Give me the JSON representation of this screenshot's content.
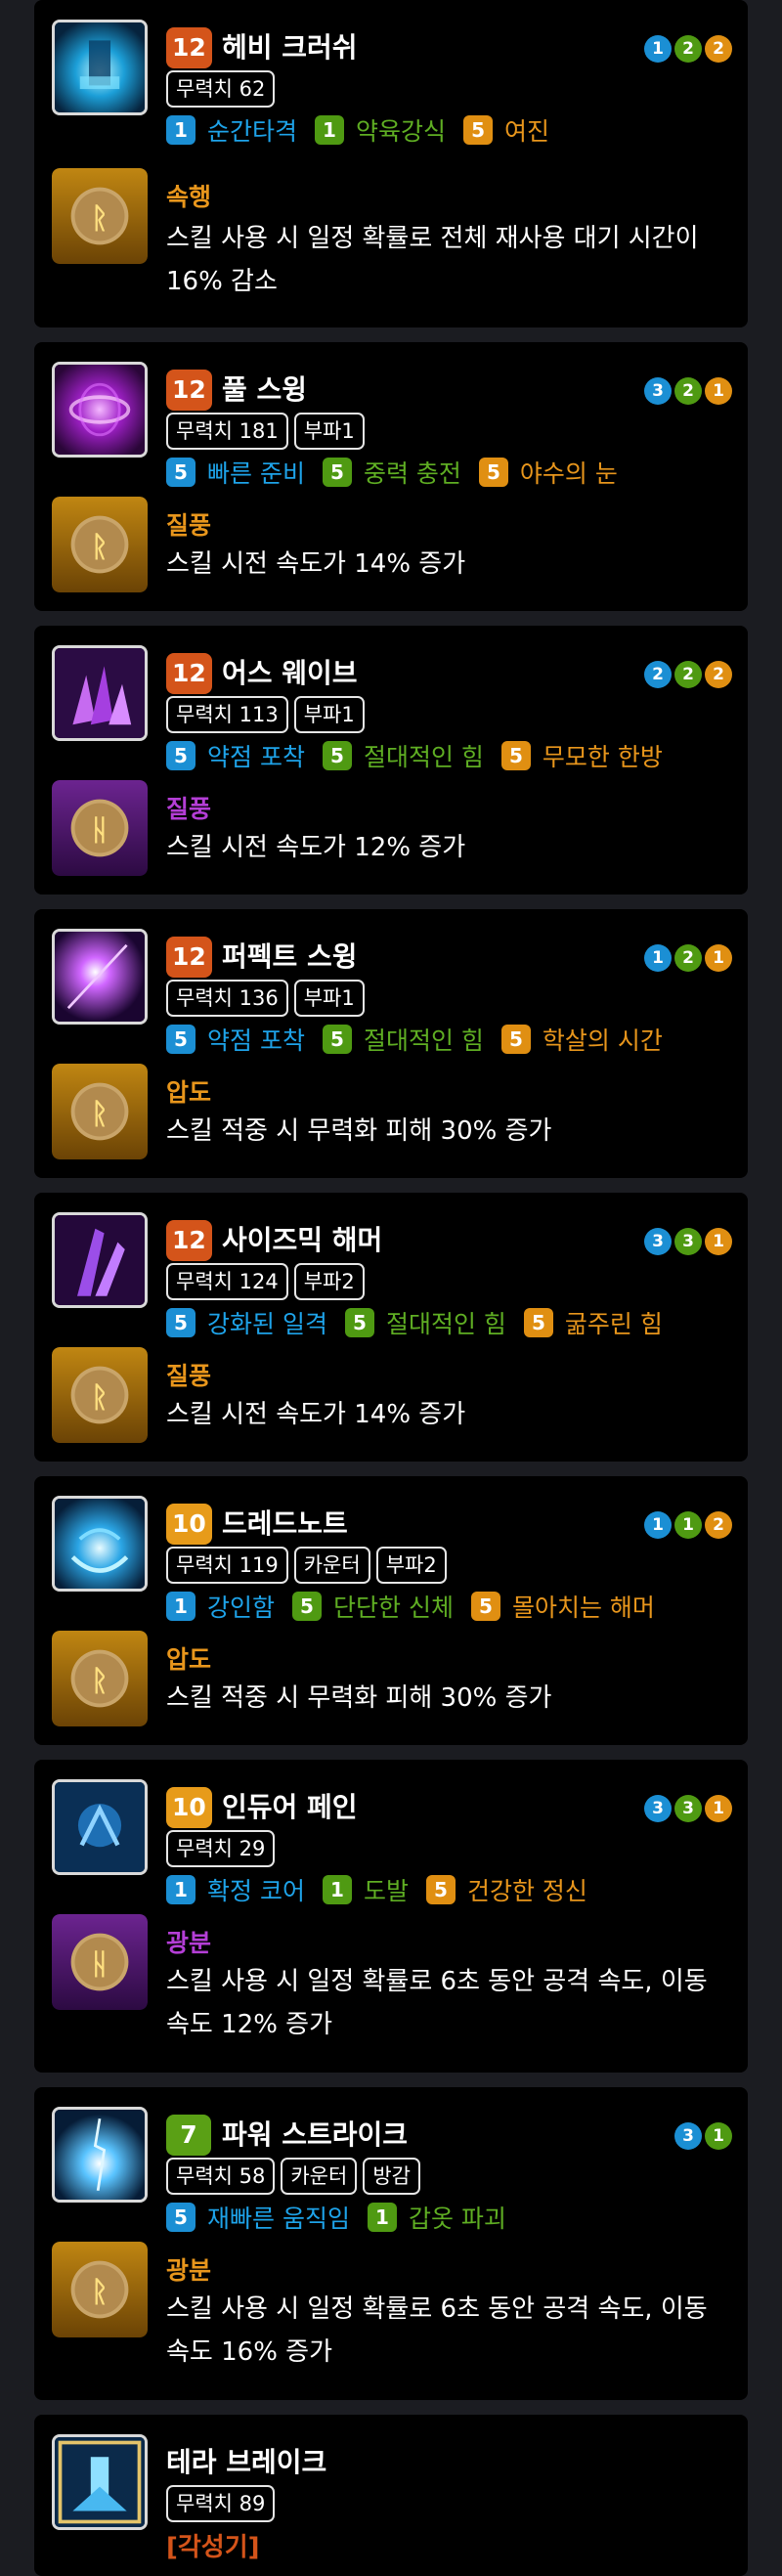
{
  "skills": [
    {
      "level": "12",
      "level_color": "#d4541a",
      "name": "헤비 크러쉬",
      "gems": [
        {
          "n": "1",
          "c": "blue"
        },
        {
          "n": "2",
          "c": "green"
        },
        {
          "n": "2",
          "c": "orange"
        }
      ],
      "tags": [
        "무력치 62"
      ],
      "tripods": [
        {
          "n": "1",
          "c": "blue",
          "label": "순간타격"
        },
        {
          "n": "1",
          "c": "green",
          "label": "약육강식"
        },
        {
          "n": "5",
          "c": "orange",
          "label": "여진"
        }
      ],
      "icon": "heavy-crush-icon",
      "rune": {
        "name": "속행",
        "color": "orange",
        "icon": "rune-haste-icon",
        "desc": "스킬 사용 시 일정 확률로 전체 재사용 대기 시간이 16% 감소"
      }
    },
    {
      "level": "12",
      "level_color": "#d4541a",
      "name": "풀 스윙",
      "gems": [
        {
          "n": "3",
          "c": "blue"
        },
        {
          "n": "2",
          "c": "green"
        },
        {
          "n": "1",
          "c": "orange"
        }
      ],
      "tags": [
        "무력치 181",
        "부파1"
      ],
      "tripods": [
        {
          "n": "5",
          "c": "blue",
          "label": "빠른 준비"
        },
        {
          "n": "5",
          "c": "green",
          "label": "중력 충전"
        },
        {
          "n": "5",
          "c": "orange",
          "label": "야수의 눈"
        }
      ],
      "icon": "full-swing-icon",
      "rune": {
        "name": "질풍",
        "color": "orange",
        "icon": "rune-gale-icon",
        "desc": "스킬 시전 속도가 14% 증가"
      }
    },
    {
      "level": "12",
      "level_color": "#d4541a",
      "name": "어스 웨이브",
      "gems": [
        {
          "n": "2",
          "c": "blue"
        },
        {
          "n": "2",
          "c": "green"
        },
        {
          "n": "2",
          "c": "orange"
        }
      ],
      "tags": [
        "무력치 113",
        "부파1"
      ],
      "tripods": [
        {
          "n": "5",
          "c": "blue",
          "label": "약점 포착"
        },
        {
          "n": "5",
          "c": "green",
          "label": "절대적인 힘"
        },
        {
          "n": "5",
          "c": "orange",
          "label": "무모한 한방"
        }
      ],
      "icon": "earth-wave-icon",
      "rune": {
        "name": "질풍",
        "color": "purple",
        "icon": "rune-gale-icon",
        "desc": "스킬 시전 속도가 12% 증가"
      }
    },
    {
      "level": "12",
      "level_color": "#d4541a",
      "name": "퍼펙트 스윙",
      "gems": [
        {
          "n": "1",
          "c": "blue"
        },
        {
          "n": "2",
          "c": "green"
        },
        {
          "n": "1",
          "c": "orange"
        }
      ],
      "tags": [
        "무력치 136",
        "부파1"
      ],
      "tripods": [
        {
          "n": "5",
          "c": "blue",
          "label": "약점 포착"
        },
        {
          "n": "5",
          "c": "green",
          "label": "절대적인 힘"
        },
        {
          "n": "5",
          "c": "orange",
          "label": "학살의 시간"
        }
      ],
      "icon": "perfect-swing-icon",
      "rune": {
        "name": "압도",
        "color": "orange",
        "icon": "rune-overwhelm-icon",
        "desc": "스킬 적중 시 무력화 피해 30% 증가"
      }
    },
    {
      "level": "12",
      "level_color": "#d4541a",
      "name": "사이즈믹 해머",
      "gems": [
        {
          "n": "3",
          "c": "blue"
        },
        {
          "n": "3",
          "c": "green"
        },
        {
          "n": "1",
          "c": "orange"
        }
      ],
      "tags": [
        "무력치 124",
        "부파2"
      ],
      "tripods": [
        {
          "n": "5",
          "c": "blue",
          "label": "강화된 일격"
        },
        {
          "n": "5",
          "c": "green",
          "label": "절대적인 힘"
        },
        {
          "n": "5",
          "c": "orange",
          "label": "굶주린 힘"
        }
      ],
      "icon": "seismic-hammer-icon",
      "rune": {
        "name": "질풍",
        "color": "orange",
        "icon": "rune-gale-icon",
        "desc": "스킬 시전 속도가 14% 증가"
      }
    },
    {
      "level": "10",
      "level_color": "#e79b1a",
      "name": "드레드노트",
      "gems": [
        {
          "n": "1",
          "c": "blue"
        },
        {
          "n": "1",
          "c": "green"
        },
        {
          "n": "2",
          "c": "orange"
        }
      ],
      "tags": [
        "무력치 119",
        "카운터",
        "부파2"
      ],
      "tripods": [
        {
          "n": "1",
          "c": "blue",
          "label": "강인함"
        },
        {
          "n": "5",
          "c": "green",
          "label": "단단한 신체"
        },
        {
          "n": "5",
          "c": "orange",
          "label": "몰아치는 해머"
        }
      ],
      "icon": "dreadnought-icon",
      "rune": {
        "name": "압도",
        "color": "orange",
        "icon": "rune-overwhelm-icon",
        "desc": "스킬 적중 시 무력화 피해 30% 증가"
      }
    },
    {
      "level": "10",
      "level_color": "#e79b1a",
      "name": "인듀어 페인",
      "gems": [
        {
          "n": "3",
          "c": "blue"
        },
        {
          "n": "3",
          "c": "green"
        },
        {
          "n": "1",
          "c": "orange"
        }
      ],
      "tags": [
        "무력치 29"
      ],
      "tripods": [
        {
          "n": "1",
          "c": "blue",
          "label": "확정 코어"
        },
        {
          "n": "1",
          "c": "green",
          "label": "도발"
        },
        {
          "n": "5",
          "c": "orange",
          "label": "건강한 정신"
        }
      ],
      "icon": "endure-pain-icon",
      "rune": {
        "name": "광분",
        "color": "purple",
        "icon": "rune-frenzy-icon",
        "desc": "스킬 사용 시 일정 확률로 6초 동안 공격 속도, 이동 속도 12% 증가"
      }
    },
    {
      "level": "7",
      "level_color": "#5aa015",
      "name": "파워 스트라이크",
      "gems": [
        {
          "n": "3",
          "c": "blue"
        },
        {
          "n": "1",
          "c": "green"
        }
      ],
      "tags": [
        "무력치 58",
        "카운터",
        "방감"
      ],
      "tripods": [
        {
          "n": "5",
          "c": "blue",
          "label": "재빠른 움직임"
        },
        {
          "n": "1",
          "c": "green",
          "label": "갑옷 파괴"
        }
      ],
      "icon": "power-strike-icon",
      "rune": {
        "name": "광분",
        "color": "orange",
        "icon": "rune-frenzy-icon",
        "desc": "스킬 사용 시 일정 확률로 6초 동안 공격 속도, 이동 속도 16% 증가"
      }
    },
    {
      "level": "",
      "level_color": "",
      "name": "테라 브레이크",
      "gems": [],
      "tags": [
        "무력치 89"
      ],
      "tripods": [],
      "icon": "terra-break-icon",
      "awakening": "[각성기]"
    }
  ],
  "palette": {
    "blue": "#1b8fd4",
    "green": "#4f9a12",
    "orange": "#e08f12",
    "text_blue": "#1ea3e9",
    "text_green": "#5fae23",
    "text_orange": "#e8961c",
    "rune_purple": "#b43ed6",
    "awaken_red": "#d4541a"
  }
}
